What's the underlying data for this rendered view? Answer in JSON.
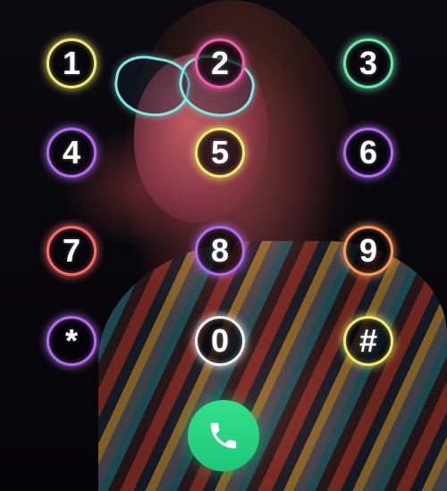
{
  "dialpad": {
    "keys": [
      {
        "label": "1",
        "ring": "yellow"
      },
      {
        "label": "2",
        "ring": "pink"
      },
      {
        "label": "3",
        "ring": "green"
      },
      {
        "label": "4",
        "ring": "purple"
      },
      {
        "label": "5",
        "ring": "yellow"
      },
      {
        "label": "6",
        "ring": "purple"
      },
      {
        "label": "7",
        "ring": "red"
      },
      {
        "label": "8",
        "ring": "purple"
      },
      {
        "label": "9",
        "ring": "orange"
      },
      {
        "label": "*",
        "ring": "purple"
      },
      {
        "label": "0",
        "ring": "white"
      },
      {
        "label": "#",
        "ring": "yellow"
      }
    ],
    "ring_colors": {
      "yellow": "#f2ec6c",
      "pink": "#f05fb0",
      "green": "#6ce8a8",
      "purple": "#b36bf0",
      "red": "#ff6b6b",
      "orange": "#ff9b5a",
      "white": "#f4f4f4"
    }
  },
  "call_button": {
    "icon": "phone-icon",
    "color": "#1ec77a"
  }
}
